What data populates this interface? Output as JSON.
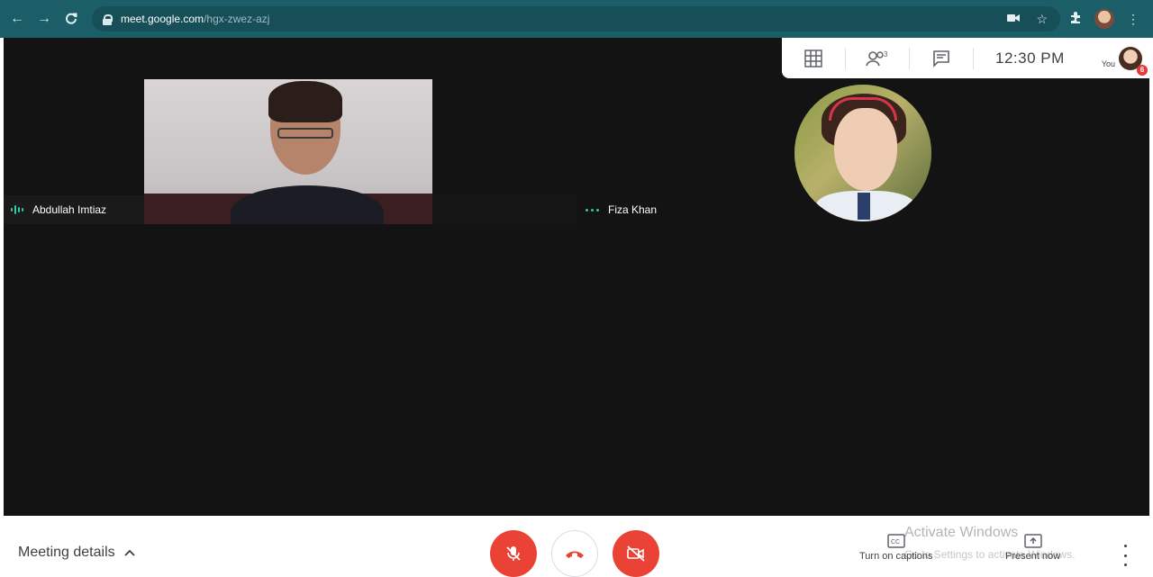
{
  "browser": {
    "url_host": "meet.google.com",
    "url_path": "/hgx-zwez-azj"
  },
  "info_panel": {
    "clock": "12:30 PM",
    "you_label": "You",
    "notification_count": "6"
  },
  "participants": [
    {
      "name": "Abdullah Imtiaz"
    },
    {
      "name": "Fiza Khan"
    }
  ],
  "controls": {
    "meeting_details_label": "Meeting details",
    "captions_label": "Turn on captions",
    "present_label": "Present now"
  },
  "watermark": {
    "title": "Activate Windows",
    "subtitle": "Go to Settings to activate Windows."
  },
  "colors": {
    "browser_bar": "#1b5e68",
    "stage_bg": "#131313",
    "danger": "#ea4335",
    "accent": "#32c9a6"
  }
}
